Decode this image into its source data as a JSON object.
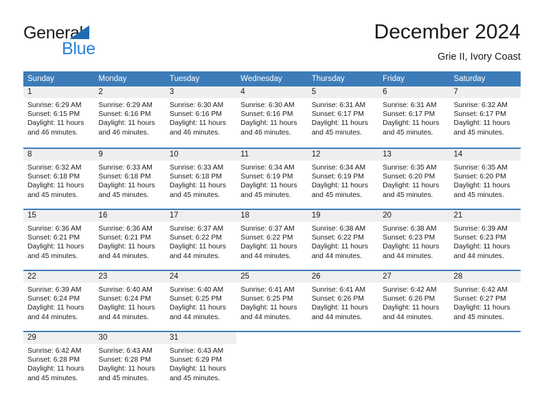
{
  "brand": {
    "name_part1": "General",
    "name_part2": "Blue",
    "triangle_color": "#1f6cb4",
    "blue_text_color": "#2a7fd4"
  },
  "header": {
    "title": "December 2024",
    "subtitle": "Grie II, Ivory Coast"
  },
  "theme": {
    "header_bg": "#3d7cb8",
    "header_text": "#ffffff",
    "daynum_band_bg": "#efefef",
    "row_divider": "#3d7cb8",
    "body_text": "#1a1a1a"
  },
  "weekdays": [
    "Sunday",
    "Monday",
    "Tuesday",
    "Wednesday",
    "Thursday",
    "Friday",
    "Saturday"
  ],
  "weeks": [
    [
      {
        "day": "1",
        "sunrise": "Sunrise: 6:29 AM",
        "sunset": "Sunset: 6:15 PM",
        "daylight_1": "Daylight: 11 hours",
        "daylight_2": "and 46 minutes."
      },
      {
        "day": "2",
        "sunrise": "Sunrise: 6:29 AM",
        "sunset": "Sunset: 6:16 PM",
        "daylight_1": "Daylight: 11 hours",
        "daylight_2": "and 46 minutes."
      },
      {
        "day": "3",
        "sunrise": "Sunrise: 6:30 AM",
        "sunset": "Sunset: 6:16 PM",
        "daylight_1": "Daylight: 11 hours",
        "daylight_2": "and 46 minutes."
      },
      {
        "day": "4",
        "sunrise": "Sunrise: 6:30 AM",
        "sunset": "Sunset: 6:16 PM",
        "daylight_1": "Daylight: 11 hours",
        "daylight_2": "and 46 minutes."
      },
      {
        "day": "5",
        "sunrise": "Sunrise: 6:31 AM",
        "sunset": "Sunset: 6:17 PM",
        "daylight_1": "Daylight: 11 hours",
        "daylight_2": "and 45 minutes."
      },
      {
        "day": "6",
        "sunrise": "Sunrise: 6:31 AM",
        "sunset": "Sunset: 6:17 PM",
        "daylight_1": "Daylight: 11 hours",
        "daylight_2": "and 45 minutes."
      },
      {
        "day": "7",
        "sunrise": "Sunrise: 6:32 AM",
        "sunset": "Sunset: 6:17 PM",
        "daylight_1": "Daylight: 11 hours",
        "daylight_2": "and 45 minutes."
      }
    ],
    [
      {
        "day": "8",
        "sunrise": "Sunrise: 6:32 AM",
        "sunset": "Sunset: 6:18 PM",
        "daylight_1": "Daylight: 11 hours",
        "daylight_2": "and 45 minutes."
      },
      {
        "day": "9",
        "sunrise": "Sunrise: 6:33 AM",
        "sunset": "Sunset: 6:18 PM",
        "daylight_1": "Daylight: 11 hours",
        "daylight_2": "and 45 minutes."
      },
      {
        "day": "10",
        "sunrise": "Sunrise: 6:33 AM",
        "sunset": "Sunset: 6:18 PM",
        "daylight_1": "Daylight: 11 hours",
        "daylight_2": "and 45 minutes."
      },
      {
        "day": "11",
        "sunrise": "Sunrise: 6:34 AM",
        "sunset": "Sunset: 6:19 PM",
        "daylight_1": "Daylight: 11 hours",
        "daylight_2": "and 45 minutes."
      },
      {
        "day": "12",
        "sunrise": "Sunrise: 6:34 AM",
        "sunset": "Sunset: 6:19 PM",
        "daylight_1": "Daylight: 11 hours",
        "daylight_2": "and 45 minutes."
      },
      {
        "day": "13",
        "sunrise": "Sunrise: 6:35 AM",
        "sunset": "Sunset: 6:20 PM",
        "daylight_1": "Daylight: 11 hours",
        "daylight_2": "and 45 minutes."
      },
      {
        "day": "14",
        "sunrise": "Sunrise: 6:35 AM",
        "sunset": "Sunset: 6:20 PM",
        "daylight_1": "Daylight: 11 hours",
        "daylight_2": "and 45 minutes."
      }
    ],
    [
      {
        "day": "15",
        "sunrise": "Sunrise: 6:36 AM",
        "sunset": "Sunset: 6:21 PM",
        "daylight_1": "Daylight: 11 hours",
        "daylight_2": "and 45 minutes."
      },
      {
        "day": "16",
        "sunrise": "Sunrise: 6:36 AM",
        "sunset": "Sunset: 6:21 PM",
        "daylight_1": "Daylight: 11 hours",
        "daylight_2": "and 44 minutes."
      },
      {
        "day": "17",
        "sunrise": "Sunrise: 6:37 AM",
        "sunset": "Sunset: 6:22 PM",
        "daylight_1": "Daylight: 11 hours",
        "daylight_2": "and 44 minutes."
      },
      {
        "day": "18",
        "sunrise": "Sunrise: 6:37 AM",
        "sunset": "Sunset: 6:22 PM",
        "daylight_1": "Daylight: 11 hours",
        "daylight_2": "and 44 minutes."
      },
      {
        "day": "19",
        "sunrise": "Sunrise: 6:38 AM",
        "sunset": "Sunset: 6:22 PM",
        "daylight_1": "Daylight: 11 hours",
        "daylight_2": "and 44 minutes."
      },
      {
        "day": "20",
        "sunrise": "Sunrise: 6:38 AM",
        "sunset": "Sunset: 6:23 PM",
        "daylight_1": "Daylight: 11 hours",
        "daylight_2": "and 44 minutes."
      },
      {
        "day": "21",
        "sunrise": "Sunrise: 6:39 AM",
        "sunset": "Sunset: 6:23 PM",
        "daylight_1": "Daylight: 11 hours",
        "daylight_2": "and 44 minutes."
      }
    ],
    [
      {
        "day": "22",
        "sunrise": "Sunrise: 6:39 AM",
        "sunset": "Sunset: 6:24 PM",
        "daylight_1": "Daylight: 11 hours",
        "daylight_2": "and 44 minutes."
      },
      {
        "day": "23",
        "sunrise": "Sunrise: 6:40 AM",
        "sunset": "Sunset: 6:24 PM",
        "daylight_1": "Daylight: 11 hours",
        "daylight_2": "and 44 minutes."
      },
      {
        "day": "24",
        "sunrise": "Sunrise: 6:40 AM",
        "sunset": "Sunset: 6:25 PM",
        "daylight_1": "Daylight: 11 hours",
        "daylight_2": "and 44 minutes."
      },
      {
        "day": "25",
        "sunrise": "Sunrise: 6:41 AM",
        "sunset": "Sunset: 6:25 PM",
        "daylight_1": "Daylight: 11 hours",
        "daylight_2": "and 44 minutes."
      },
      {
        "day": "26",
        "sunrise": "Sunrise: 6:41 AM",
        "sunset": "Sunset: 6:26 PM",
        "daylight_1": "Daylight: 11 hours",
        "daylight_2": "and 44 minutes."
      },
      {
        "day": "27",
        "sunrise": "Sunrise: 6:42 AM",
        "sunset": "Sunset: 6:26 PM",
        "daylight_1": "Daylight: 11 hours",
        "daylight_2": "and 44 minutes."
      },
      {
        "day": "28",
        "sunrise": "Sunrise: 6:42 AM",
        "sunset": "Sunset: 6:27 PM",
        "daylight_1": "Daylight: 11 hours",
        "daylight_2": "and 45 minutes."
      }
    ],
    [
      {
        "day": "29",
        "sunrise": "Sunrise: 6:42 AM",
        "sunset": "Sunset: 6:28 PM",
        "daylight_1": "Daylight: 11 hours",
        "daylight_2": "and 45 minutes."
      },
      {
        "day": "30",
        "sunrise": "Sunrise: 6:43 AM",
        "sunset": "Sunset: 6:28 PM",
        "daylight_1": "Daylight: 11 hours",
        "daylight_2": "and 45 minutes."
      },
      {
        "day": "31",
        "sunrise": "Sunrise: 6:43 AM",
        "sunset": "Sunset: 6:29 PM",
        "daylight_1": "Daylight: 11 hours",
        "daylight_2": "and 45 minutes."
      },
      {
        "day": "",
        "sunrise": "",
        "sunset": "",
        "daylight_1": "",
        "daylight_2": ""
      },
      {
        "day": "",
        "sunrise": "",
        "sunset": "",
        "daylight_1": "",
        "daylight_2": ""
      },
      {
        "day": "",
        "sunrise": "",
        "sunset": "",
        "daylight_1": "",
        "daylight_2": ""
      },
      {
        "day": "",
        "sunrise": "",
        "sunset": "",
        "daylight_1": "",
        "daylight_2": ""
      }
    ]
  ]
}
